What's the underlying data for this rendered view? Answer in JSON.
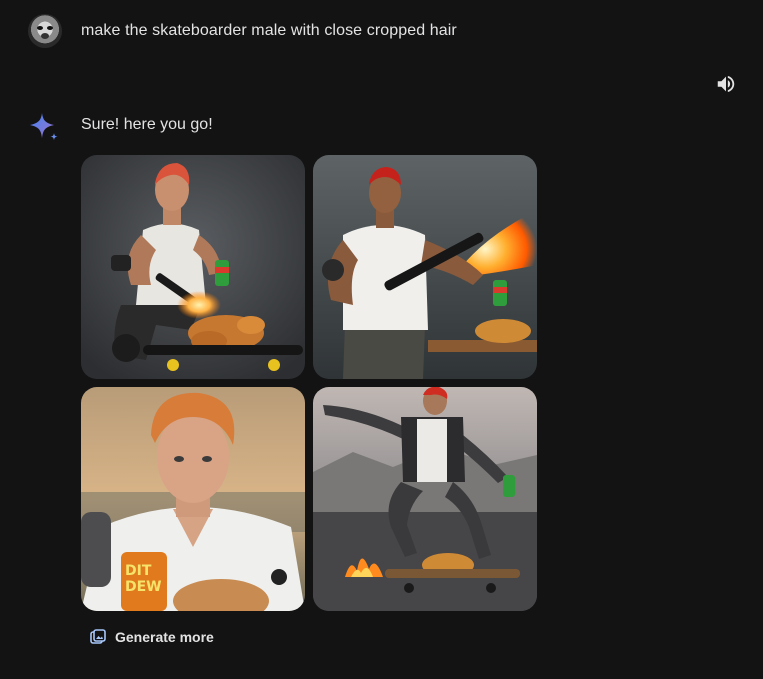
{
  "user_message": {
    "text": "make the skateboarder male with close cropped hair"
  },
  "response": {
    "text": "Sure! here you go!",
    "images": [
      {
        "alt": "generated image 1"
      },
      {
        "alt": "generated image 2"
      },
      {
        "alt": "generated image 3"
      },
      {
        "alt": "generated image 4"
      }
    ],
    "can_label_1": "DIT",
    "can_label_2": "DEW"
  },
  "actions": {
    "generate_more_label": "Generate more"
  },
  "icons": {
    "avatar": "user-avatar",
    "speaker": "speaker-icon",
    "sparkle": "gemini-sparkle-icon",
    "generate": "image-generate-icon"
  },
  "colors": {
    "background": "#131314",
    "text": "#e3e3e3",
    "sparkle_start": "#4285f4",
    "sparkle_end": "#9b72cb"
  }
}
